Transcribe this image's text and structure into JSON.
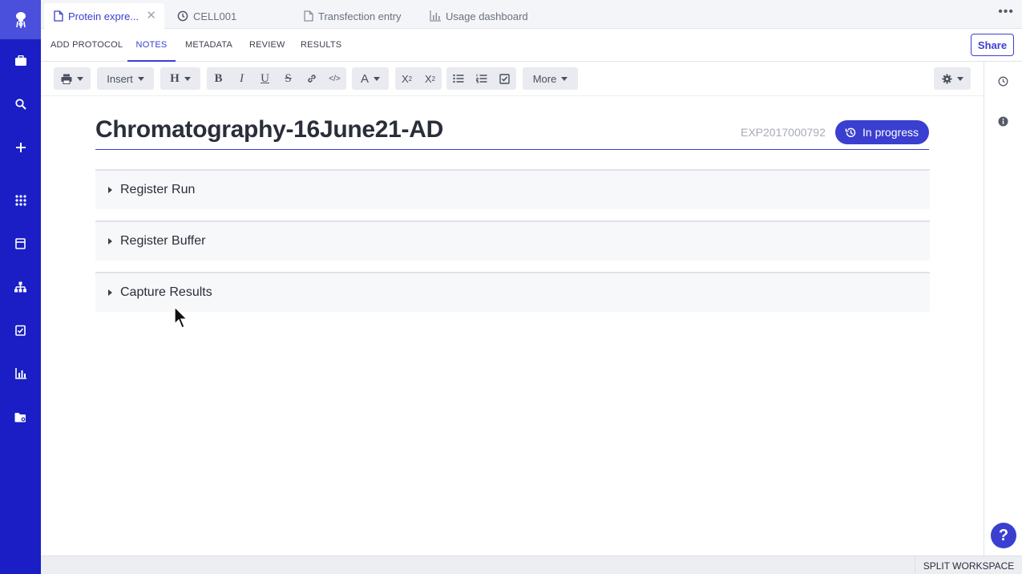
{
  "tabs": [
    {
      "label": "Protein expre...",
      "icon": "document-icon",
      "active": true
    },
    {
      "label": "CELL001",
      "icon": "clock-icon",
      "active": false
    },
    {
      "label": "Transfection entry",
      "icon": "document-icon",
      "active": false
    },
    {
      "label": "Usage dashboard",
      "icon": "bar-chart-icon",
      "active": false
    }
  ],
  "section_tabs": [
    "ADD PROTOCOL",
    "NOTES",
    "METADATA",
    "REVIEW",
    "RESULTS"
  ],
  "share_label": "Share",
  "toolbar": {
    "insert_label": "Insert",
    "heading_label": "H",
    "bold_label": "B",
    "italic_label": "I",
    "underline_label": "U",
    "strike_label": "S",
    "code_label": "</>",
    "font_color_label": "A",
    "subscript_label": "X",
    "superscript_label": "X",
    "subscript_mark": "2",
    "superscript_mark": "2",
    "more_label": "More"
  },
  "document": {
    "title": "Chromatography-16June21-AD",
    "experiment_id": "EXP2017000792",
    "status": "In progress"
  },
  "sections": [
    "Register Run",
    "Register Buffer",
    "Capture Results"
  ],
  "bottom": {
    "split_label": "SPLIT WORKSPACE",
    "help_label": "?"
  },
  "colors": {
    "accent": "#3a3fd0",
    "rail": "#1a1ec4"
  }
}
